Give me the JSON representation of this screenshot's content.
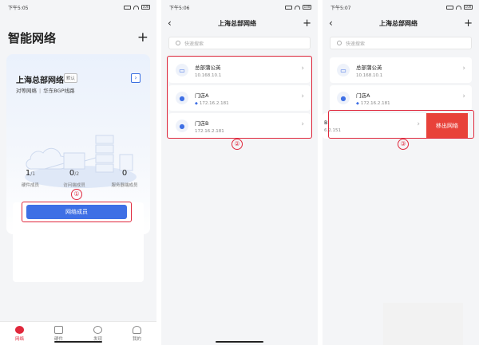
{
  "panel1": {
    "status_time": "下午5:05",
    "title": "智能网络",
    "plus": "+",
    "card": {
      "name": "上海总部网络",
      "tag": "默认",
      "arrow": "›",
      "type": "对等网络",
      "line": "华东BGP线路",
      "stats": [
        {
          "value": "1",
          "total": "/1",
          "label": "硬件成员"
        },
        {
          "value": "0",
          "total": "/2",
          "label": "访问端成员"
        },
        {
          "value": "0",
          "total": "",
          "label": "服务器端成员"
        }
      ],
      "button": "网络成员"
    },
    "step": "①",
    "tabs": [
      {
        "label": "网络",
        "active": true
      },
      {
        "label": "硬件",
        "active": false
      },
      {
        "label": "发现",
        "active": false
      },
      {
        "label": "我的",
        "active": false
      }
    ]
  },
  "panel2": {
    "status_time": "下午5:06",
    "back": "‹",
    "title": "上海总部网络",
    "plus": "+",
    "search_placeholder": "快速搜索",
    "step": "②",
    "members": [
      {
        "name": "总部蒲公英",
        "ip": "10.168.10.1",
        "icon": "router-icon"
      },
      {
        "name": "门店A",
        "ip": "172.16.2.181",
        "icon": "user-icon"
      },
      {
        "name": "门店B",
        "ip": "172.16.2.181",
        "icon": "user-icon"
      }
    ]
  },
  "panel3": {
    "status_time": "下午5:07",
    "back": "‹",
    "title": "上海总部网络",
    "plus": "+",
    "search_placeholder": "快速搜索",
    "step": "③",
    "members": [
      {
        "name": "总部蒲公英",
        "ip": "10.168.10.1"
      },
      {
        "name": "门店A",
        "ip": "172.16.2.181"
      },
      {
        "name": "B",
        "ip": "6.2.151"
      }
    ],
    "remove_label": "移出网络"
  },
  "status_battery": "100",
  "chevron": "›",
  "colors": {
    "accent": "#3e6fe5",
    "highlight": "#e0283c",
    "danger": "#e8423a"
  }
}
